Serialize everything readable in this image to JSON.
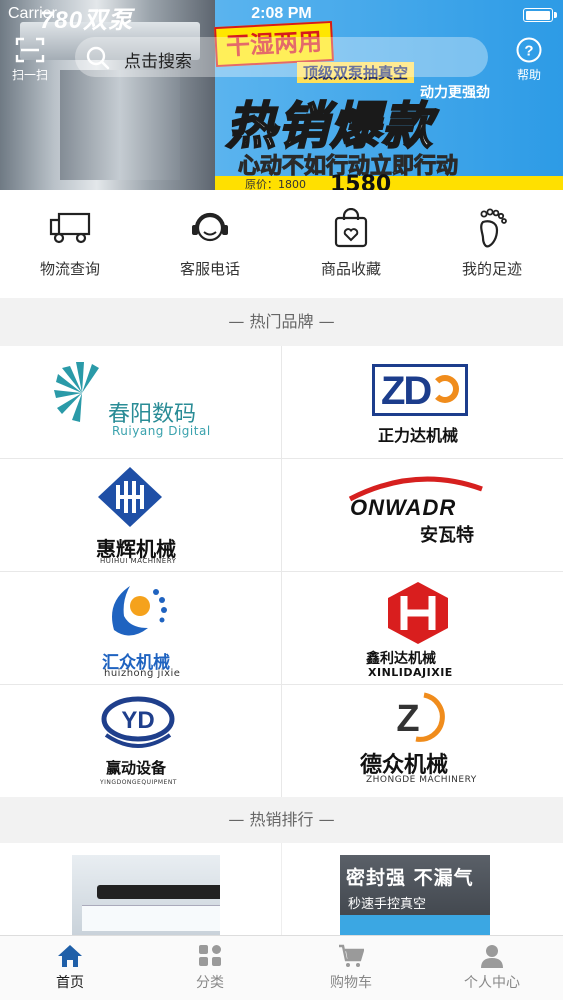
{
  "status_bar": {
    "carrier": "Carrier",
    "time": "2:08 PM"
  },
  "banner": {
    "brand": "780双泵",
    "badge": "干湿两用",
    "tag1": "顶级双泵抽真空",
    "tag2": "动力更强劲",
    "headline": "热销爆款",
    "slogan": "心动不如行动立即行动",
    "price_label": "原价：1800",
    "price": "1580"
  },
  "top_controls": {
    "scan_label": "扫一扫",
    "search_placeholder": "点击搜索",
    "help_label": "帮助"
  },
  "quick_menu": [
    {
      "label": "物流查询",
      "icon": "truck-icon"
    },
    {
      "label": "客服电话",
      "icon": "headset-icon"
    },
    {
      "label": "商品收藏",
      "icon": "bag-heart-icon"
    },
    {
      "label": "我的足迹",
      "icon": "footprint-icon"
    }
  ],
  "sections": {
    "brands": "— 热门品牌 —",
    "hot_sales": "— 热销排行 —"
  },
  "brands": [
    {
      "name": "春阳数码",
      "sub": "Ruiyang Digital"
    },
    {
      "name": "正力达机械",
      "sub": "ZD"
    },
    {
      "name": "惠辉机械",
      "sub": "HUIHUI MACHINERY"
    },
    {
      "name": "安瓦特",
      "sub": "ONWADR"
    },
    {
      "name": "汇众机械",
      "sub": "huizhong jixie"
    },
    {
      "name": "鑫利达机械",
      "sub": "XINLIDAJIXIE"
    },
    {
      "name": "赢动设备",
      "sub": "YINGDONGEQUIPMENT"
    },
    {
      "name": "德众机械",
      "sub": "ZHONGDE MACHINERY"
    }
  ],
  "brand_marks": {
    "zd": "ZD",
    "yd": "YD",
    "z": "Z"
  },
  "products": [
    {
      "headline": "",
      "sub": ""
    },
    {
      "headline": "密封强 不漏气",
      "sub": "秒速手控真空"
    }
  ],
  "tab_bar": [
    {
      "label": "首页",
      "icon": "home-icon",
      "active": true
    },
    {
      "label": "分类",
      "icon": "category-icon",
      "active": false
    },
    {
      "label": "购物车",
      "icon": "cart-icon",
      "active": false
    },
    {
      "label": "个人中心",
      "icon": "user-icon",
      "active": false
    }
  ],
  "colors": {
    "accent_blue": "#2d9be6",
    "tab_active": "#1f5fa8",
    "tab_inactive": "#9a9a9a"
  }
}
